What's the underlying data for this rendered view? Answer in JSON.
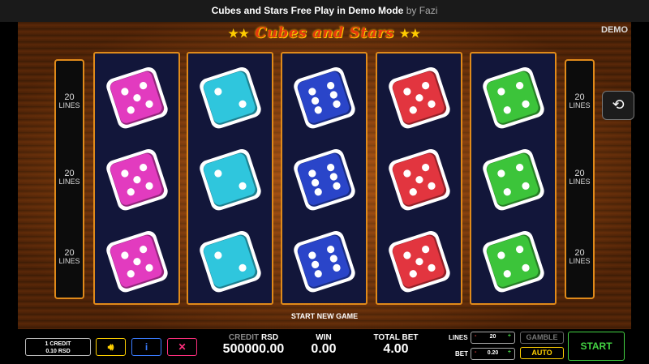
{
  "header": {
    "title": "Cubes and Stars Free Play in Demo Mode",
    "byline": "by Fazi"
  },
  "game": {
    "logo": "Cubes and Stars",
    "mode": "DEMO",
    "lines_indicators": [
      {
        "num": "20",
        "label": "LINES"
      },
      {
        "num": "20",
        "label": "LINES"
      },
      {
        "num": "20",
        "label": "LINES"
      }
    ],
    "reels": [
      {
        "color": "#e23bbf",
        "faces": [
          5,
          5,
          5
        ]
      },
      {
        "color": "#2fc6dd",
        "faces": [
          2,
          2,
          2
        ]
      },
      {
        "color": "#2a45c9",
        "faces": [
          6,
          6,
          6
        ]
      },
      {
        "color": "#e2353f",
        "faces": [
          5,
          5,
          5
        ]
      },
      {
        "color": "#3cc43a",
        "faces": [
          4,
          4,
          4
        ]
      }
    ],
    "start_new_game": "START NEW GAME",
    "history_icon": "history-icon"
  },
  "bottom": {
    "credit_line1": "1 CREDIT",
    "credit_line2": "0.10 RSD",
    "sound_icon": "sound-icon",
    "info_icon": "info-icon",
    "fullscreen_icon": "fullscreen-icon",
    "credit": {
      "label": "CREDIT",
      "currency": "RSD",
      "value": "500000.00"
    },
    "win": {
      "label": "WIN",
      "value": "0.00"
    },
    "total_bet": {
      "label": "TOTAL BET",
      "value": "4.00"
    },
    "lines": {
      "label": "LINES",
      "value": "20",
      "minus": "-",
      "plus": "+"
    },
    "bet": {
      "label": "BET",
      "value": "0.20",
      "minus": "-",
      "plus": "+"
    },
    "gamble_label": "GAMBLE",
    "auto_label": "AUTO",
    "start_label": "START"
  }
}
